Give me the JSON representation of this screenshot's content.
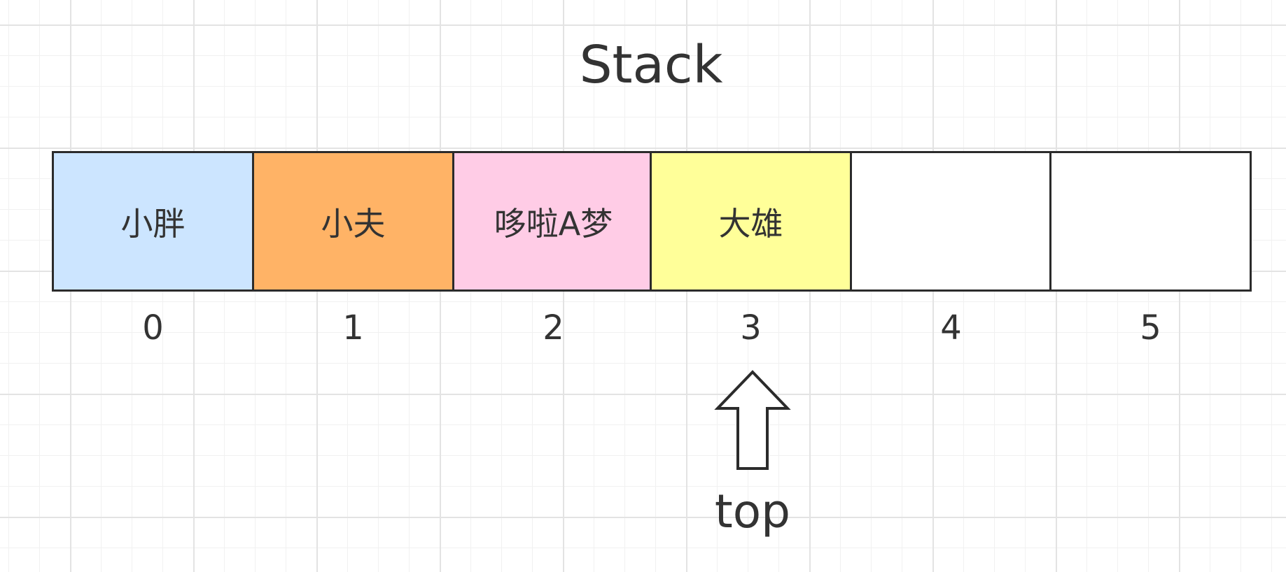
{
  "title": "Stack",
  "cells": [
    {
      "index": "0",
      "label": "小胖",
      "color": "#cce5ff"
    },
    {
      "index": "1",
      "label": "小夫",
      "color": "#ffb366"
    },
    {
      "index": "2",
      "label": "哆啦A梦",
      "color": "#ffcce6"
    },
    {
      "index": "3",
      "label": "大雄",
      "color": "#ffff99"
    },
    {
      "index": "4",
      "label": "",
      "color": "#ffffff"
    },
    {
      "index": "5",
      "label": "",
      "color": "#ffffff"
    }
  ],
  "pointer": {
    "label": "top",
    "target_index": "3",
    "icon": "up-arrow-icon"
  }
}
